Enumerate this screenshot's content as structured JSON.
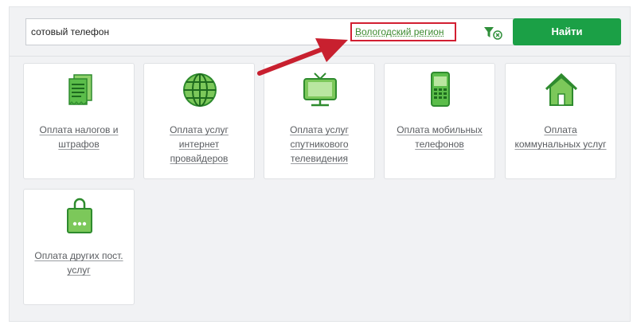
{
  "search": {
    "query": "сотовый телефон",
    "region_label": "Вологодский регион",
    "button_label": "Найти"
  },
  "services": [
    {
      "label": "Оплата налогов и штрафов",
      "icon": "tax-document-icon"
    },
    {
      "label": "Оплата услуг интернет провайдеров",
      "icon": "globe-icon"
    },
    {
      "label": "Оплата услуг спутникового телевидения",
      "icon": "tv-icon"
    },
    {
      "label": "Оплата мобильных телефонов",
      "icon": "mobile-phone-icon"
    },
    {
      "label": "Оплата коммунальных услуг",
      "icon": "house-icon"
    },
    {
      "label": "Оплата других пост. услуг",
      "icon": "shopping-bag-icon"
    }
  ],
  "colors": {
    "accent_green": "#1ba046",
    "icon_green": "#3aa63a",
    "highlight_red": "#d21f32",
    "arrow_red": "#c8202f"
  }
}
